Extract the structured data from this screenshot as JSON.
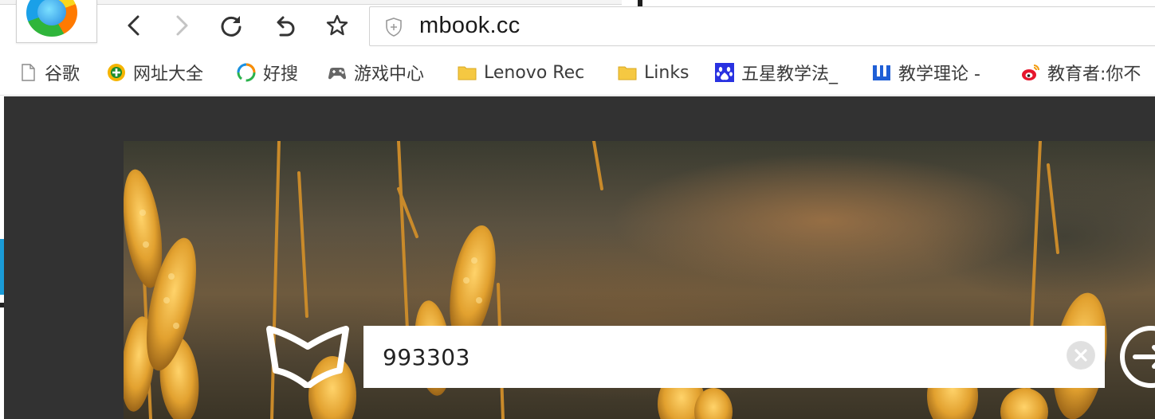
{
  "browser": {
    "url": "mbook.cc",
    "icons": {
      "back": "chevron-left-icon",
      "forward": "chevron-right-icon",
      "reload": "reload-icon",
      "undo": "undo-icon",
      "favorite": "star-icon",
      "security": "shield-icon"
    }
  },
  "bookmarks": [
    {
      "label": "谷歌",
      "icon": "page-icon"
    },
    {
      "label": "网址大全",
      "icon": "site-nav-icon"
    },
    {
      "label": "好搜",
      "icon": "haosou-icon"
    },
    {
      "label": "游戏中心",
      "icon": "gamepad-icon"
    },
    {
      "label": "Lenovo Rec",
      "icon": "folder-icon"
    },
    {
      "label": "Links",
      "icon": "folder-icon"
    },
    {
      "label": "五星教学法_",
      "icon": "baidu-paw-icon"
    },
    {
      "label": "教学理论 -",
      "icon": "w-logo-icon"
    },
    {
      "label": "教育者:你不",
      "icon": "weibo-icon"
    }
  ],
  "search": {
    "value": "993303",
    "clear_icon": "clear-icon",
    "submit_icon": "arrow-right-icon"
  },
  "colors": {
    "page_bg": "#323232",
    "input_bg": "#ffffff",
    "folder": "#f5c842",
    "bookmark_text": "#3b3b3b"
  }
}
